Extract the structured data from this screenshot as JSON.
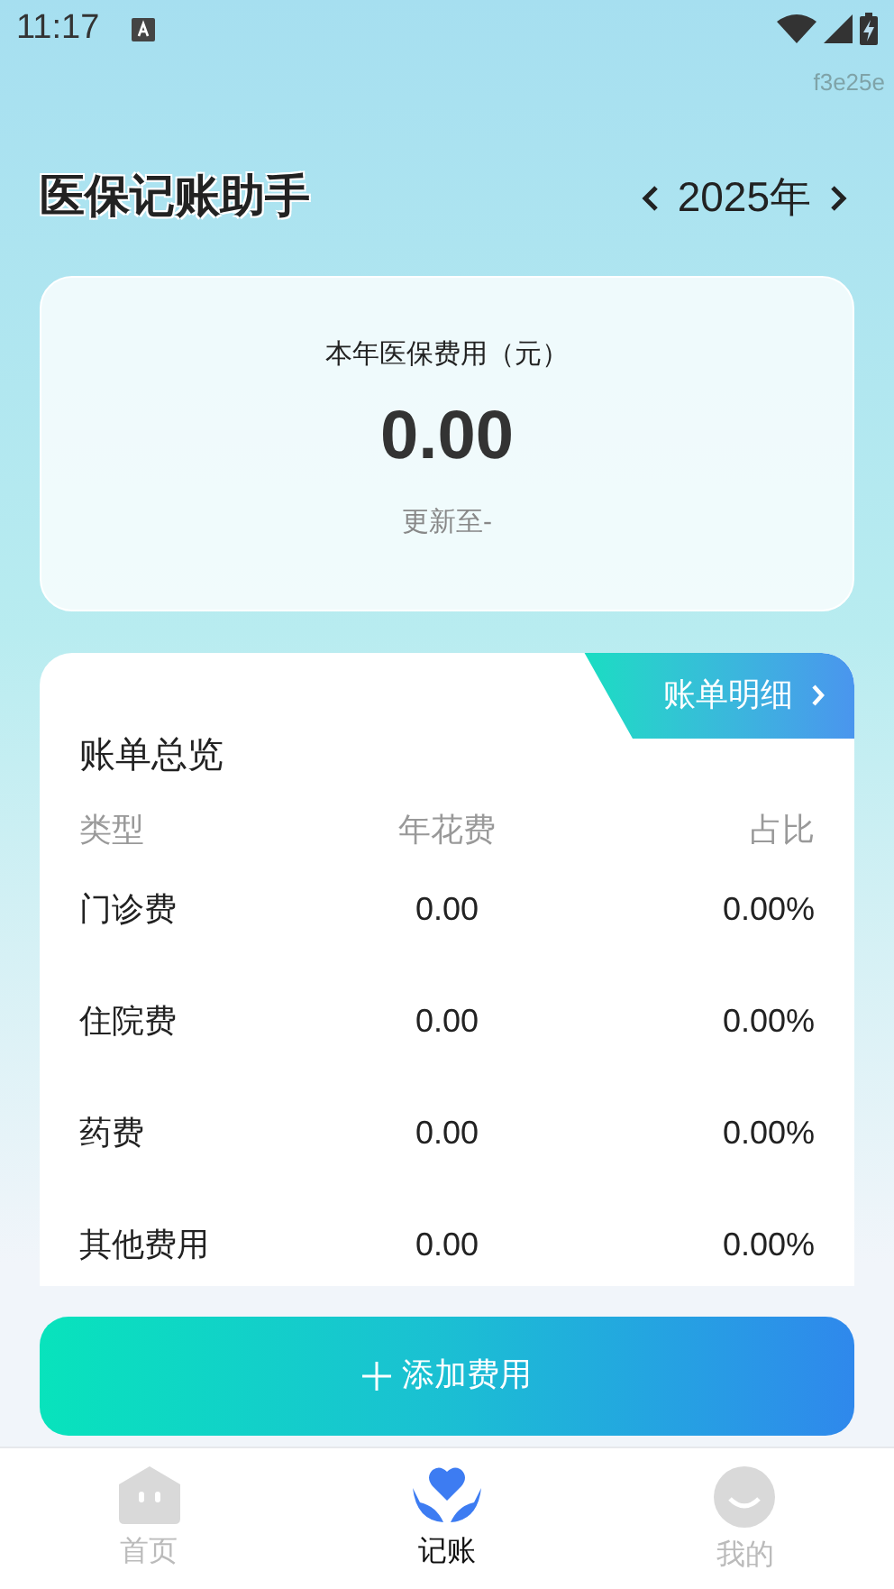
{
  "status_bar": {
    "time": "11:17"
  },
  "tag": "f3e25e",
  "header": {
    "title": "医保记账助手",
    "year": "2025年"
  },
  "summary": {
    "label": "本年医保费用（元）",
    "amount": "0.00",
    "updated": "更新至-"
  },
  "bill": {
    "title": "账单总览",
    "detail_link": "账单明细",
    "columns": [
      "类型",
      "年花费",
      "占比"
    ],
    "rows": [
      [
        "门诊费",
        "0.00",
        "0.00%"
      ],
      [
        "住院费",
        "0.00",
        "0.00%"
      ],
      [
        "药费",
        "0.00",
        "0.00%"
      ],
      [
        "其他费用",
        "0.00",
        "0.00%"
      ]
    ]
  },
  "add_button": {
    "label": "添加费用"
  },
  "nav": [
    {
      "label": "首页",
      "kind": "home",
      "selected": false
    },
    {
      "label": "记账",
      "kind": "ledger",
      "selected": true
    },
    {
      "label": "我的",
      "kind": "me",
      "selected": false
    }
  ]
}
